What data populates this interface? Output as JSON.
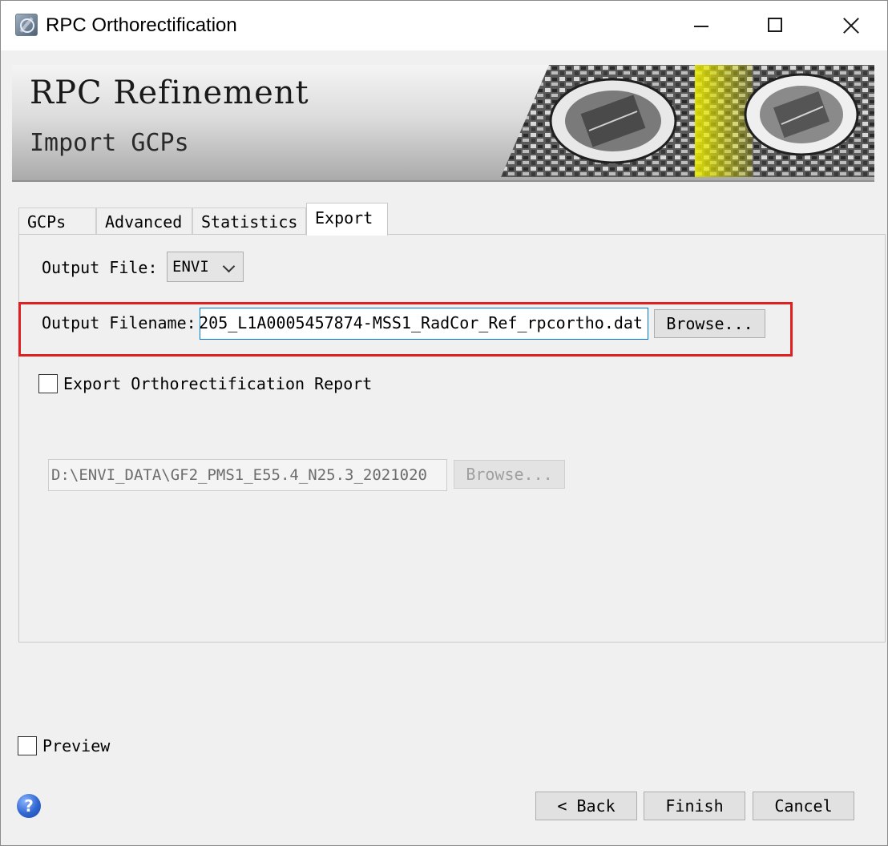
{
  "window": {
    "title": "RPC Orthorectification"
  },
  "banner": {
    "title": "RPC Refinement",
    "subtitle": "Import GCPs"
  },
  "tabs": [
    {
      "label": "GCPs"
    },
    {
      "label": "Advanced"
    },
    {
      "label": "Statistics"
    },
    {
      "label": "Export",
      "active": true
    }
  ],
  "export": {
    "output_file_label": "Output File:",
    "output_file_value": "ENVI",
    "output_filename_label": "Output Filename:",
    "output_filename_value": "205_L1A0005457874-MSS1_RadCor_Ref_rpcortho.dat",
    "browse_label": "Browse...",
    "report_checkbox_label": "Export Orthorectification Report",
    "report_checked": false,
    "report_path_value": "D:\\ENVI_DATA\\GF2_PMS1_E55.4_N25.3_2021020",
    "report_browse_label": "Browse..."
  },
  "preview": {
    "label": "Preview",
    "checked": false
  },
  "footer": {
    "help_glyph": "?",
    "back_label": "< Back",
    "finish_label": "Finish",
    "cancel_label": "Cancel"
  },
  "colors": {
    "highlight_border": "#e02020",
    "input_focus_border": "#0078d7",
    "banner_image_accent": "#e6e600"
  }
}
